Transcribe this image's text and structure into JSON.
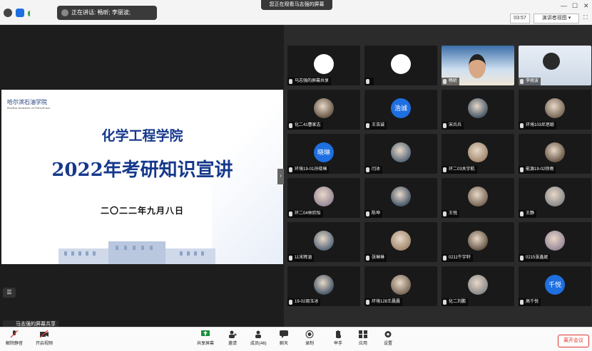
{
  "topbar": {
    "speaking_text": "正在讲话: 畅昕; 李丽波;",
    "watching_text": "您正在观看马志强的屏幕",
    "timer": "03:57",
    "view_label": "演讲者视图",
    "win_controls": [
      "—",
      "☐",
      "✕"
    ]
  },
  "slide": {
    "logo_text": "哈尔滨石油学院",
    "logo_sub": "Harbin Institute of Petroleum",
    "title1": "化学工程学院",
    "title2": "2022年考研知识宣讲",
    "date": "二〇二二年九月八日"
  },
  "share_label": "马志强的屏幕共享",
  "tiles": [
    {
      "name": "马志强的屏幕共享",
      "avatar": "white",
      "text": ""
    },
    {
      "name": "",
      "avatar": "white",
      "text": ""
    },
    {
      "name": "畅昕",
      "avatar": "photo",
      "text": ""
    },
    {
      "name": "李丽波",
      "avatar": "photo2",
      "text": ""
    },
    {
      "name": "化二41曹家志",
      "avatar": "photo",
      "text": ""
    },
    {
      "name": "王浩诚",
      "avatar": "blue",
      "text": "浩诚"
    },
    {
      "name": "宋兵兵",
      "avatar": "photo",
      "text": ""
    },
    {
      "name": "环境103尼思聪",
      "avatar": "photo",
      "text": ""
    },
    {
      "name": "环境19-01孙晓琳",
      "avatar": "blue",
      "text": "晓琳"
    },
    {
      "name": "闫冰",
      "avatar": "photo",
      "text": ""
    },
    {
      "name": "环二03关宇航",
      "avatar": "photo",
      "text": ""
    },
    {
      "name": "能源19-02徐雨",
      "avatar": "photo",
      "text": ""
    },
    {
      "name": "环二04林欣怡",
      "avatar": "photo",
      "text": ""
    },
    {
      "name": "陈坤",
      "avatar": "photo",
      "text": ""
    },
    {
      "name": "王悦",
      "avatar": "photo",
      "text": ""
    },
    {
      "name": "王静",
      "avatar": "photo",
      "text": ""
    },
    {
      "name": "11宋辉涵",
      "avatar": "photo",
      "text": ""
    },
    {
      "name": "张琳琳",
      "avatar": "photo",
      "text": ""
    },
    {
      "name": "0211牛宇轩",
      "avatar": "photo",
      "text": ""
    },
    {
      "name": "0215张鑫妮",
      "avatar": "photo",
      "text": ""
    },
    {
      "name": "19-02周玉冰",
      "avatar": "photo",
      "text": ""
    },
    {
      "name": "环境128王晨晨",
      "avatar": "photo",
      "text": ""
    },
    {
      "name": "化二刘鹏",
      "avatar": "photo",
      "text": ""
    },
    {
      "name": "高千悦",
      "avatar": "blue",
      "text": "千悦"
    }
  ],
  "toolbar": {
    "mute": "解除静音",
    "video": "开启视频",
    "share": "共享屏幕",
    "invite": "邀请",
    "members": "成员(46)",
    "chat": "聊天",
    "record": "录制",
    "raise": "举手",
    "apps": "应用",
    "settings": "设置",
    "leave": "离开会议"
  },
  "colors": {
    "accent_blue": "#1e6fe0",
    "leave_red": "#e0342c",
    "slide_title": "#16388c"
  }
}
